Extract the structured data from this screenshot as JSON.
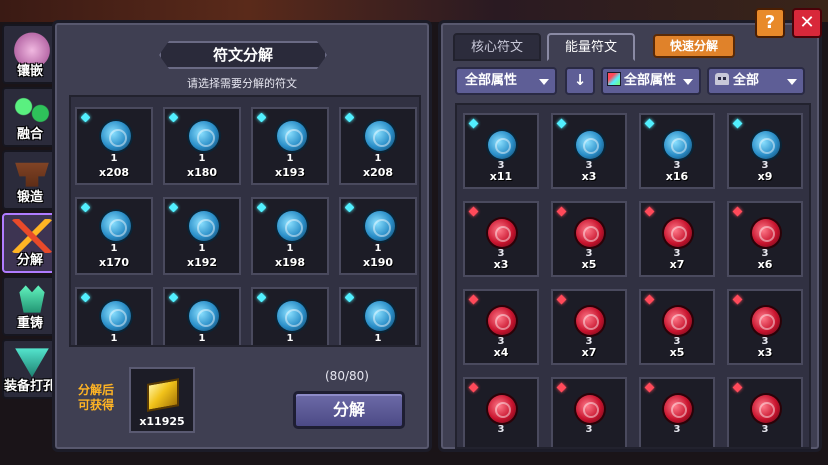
{
  "side_tabs": [
    {
      "label": "镶嵌",
      "icon": "pink-potion-icon",
      "color": "#d89ac8"
    },
    {
      "label": "融合",
      "icon": "green-orbs-icon",
      "color": "#2ec25a"
    },
    {
      "label": "锻造",
      "icon": "anvil-icon",
      "color": "#8a4a2a"
    },
    {
      "label": "分解",
      "icon": "crossed-swords-icon",
      "color": "#e84a2a",
      "active": true
    },
    {
      "label": "重铸",
      "icon": "crystal-icon",
      "color": "#2aa87a"
    },
    {
      "label": "装备打孔",
      "icon": "drill-icon",
      "color": "#3ac2a8"
    }
  ],
  "left_panel": {
    "title": "符文分解",
    "subtitle": "请选择需要分解的符文",
    "slots": [
      {
        "level": "1",
        "count": "x208"
      },
      {
        "level": "1",
        "count": "x180"
      },
      {
        "level": "1",
        "count": "x193"
      },
      {
        "level": "1",
        "count": "x208"
      },
      {
        "level": "1",
        "count": "x170"
      },
      {
        "level": "1",
        "count": "x192"
      },
      {
        "level": "1",
        "count": "x198"
      },
      {
        "level": "1",
        "count": "x190"
      },
      {
        "level": "1",
        "count": ""
      },
      {
        "level": "1",
        "count": ""
      },
      {
        "level": "1",
        "count": ""
      },
      {
        "level": "1",
        "count": ""
      }
    ],
    "obtain_label": "分解后可获得",
    "reward_count": "x11925",
    "capacity": "(80/80)",
    "decompose_button": "分解"
  },
  "right_panel": {
    "tabs": [
      {
        "label": "核心符文",
        "active": false
      },
      {
        "label": "能量符文",
        "active": true
      }
    ],
    "quick_decompose_button": "快速分解",
    "filters": {
      "attribute_1": "全部属性",
      "sort_icon": "down-arrow-icon",
      "attribute_2": "全部属性",
      "monster": "全部"
    },
    "slots": [
      {
        "color": "blue",
        "tier": "3",
        "count": "x11"
      },
      {
        "color": "blue",
        "tier": "3",
        "count": "x3"
      },
      {
        "color": "blue",
        "tier": "3",
        "count": "x16"
      },
      {
        "color": "blue",
        "tier": "3",
        "count": "x9"
      },
      {
        "color": "red",
        "tier": "3",
        "count": "x3"
      },
      {
        "color": "red",
        "tier": "3",
        "count": "x5"
      },
      {
        "color": "red",
        "tier": "3",
        "count": "x7"
      },
      {
        "color": "red",
        "tier": "3",
        "count": "x6"
      },
      {
        "color": "red",
        "tier": "3",
        "count": "x4"
      },
      {
        "color": "red",
        "tier": "3",
        "count": "x7"
      },
      {
        "color": "red",
        "tier": "3",
        "count": "x5"
      },
      {
        "color": "red",
        "tier": "3",
        "count": "x3"
      },
      {
        "color": "red",
        "tier": "3",
        "count": ""
      },
      {
        "color": "red",
        "tier": "3",
        "count": ""
      },
      {
        "color": "red",
        "tier": "3",
        "count": ""
      },
      {
        "color": "red",
        "tier": "3",
        "count": ""
      }
    ]
  },
  "top_buttons": {
    "help": "?",
    "close": "✕"
  },
  "colors": {
    "panel": "#3f3f52",
    "accent_orange": "#e0822a",
    "obtain_text": "#ffb424",
    "close_red": "#d8283a"
  }
}
